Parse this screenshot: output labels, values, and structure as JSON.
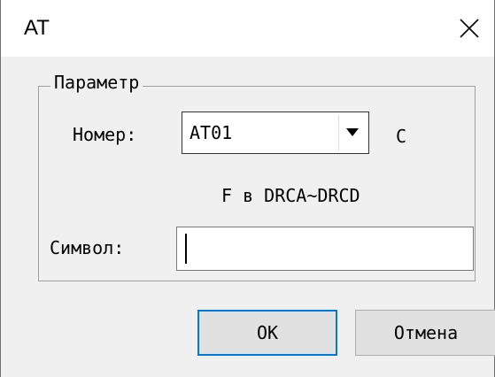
{
  "window": {
    "title": "AT"
  },
  "parameter_group": {
    "label": "Параметр",
    "number_label": "Номер:",
    "number_value": "AT01",
    "unit": "C",
    "range_text": "F в DRCA~DRCD",
    "symbol_label": "Символ:",
    "symbol_value": ""
  },
  "buttons": {
    "ok": "OK",
    "cancel": "Отмена"
  },
  "icons": {
    "close": "close-icon",
    "dropdown": "chevron-down-icon"
  }
}
